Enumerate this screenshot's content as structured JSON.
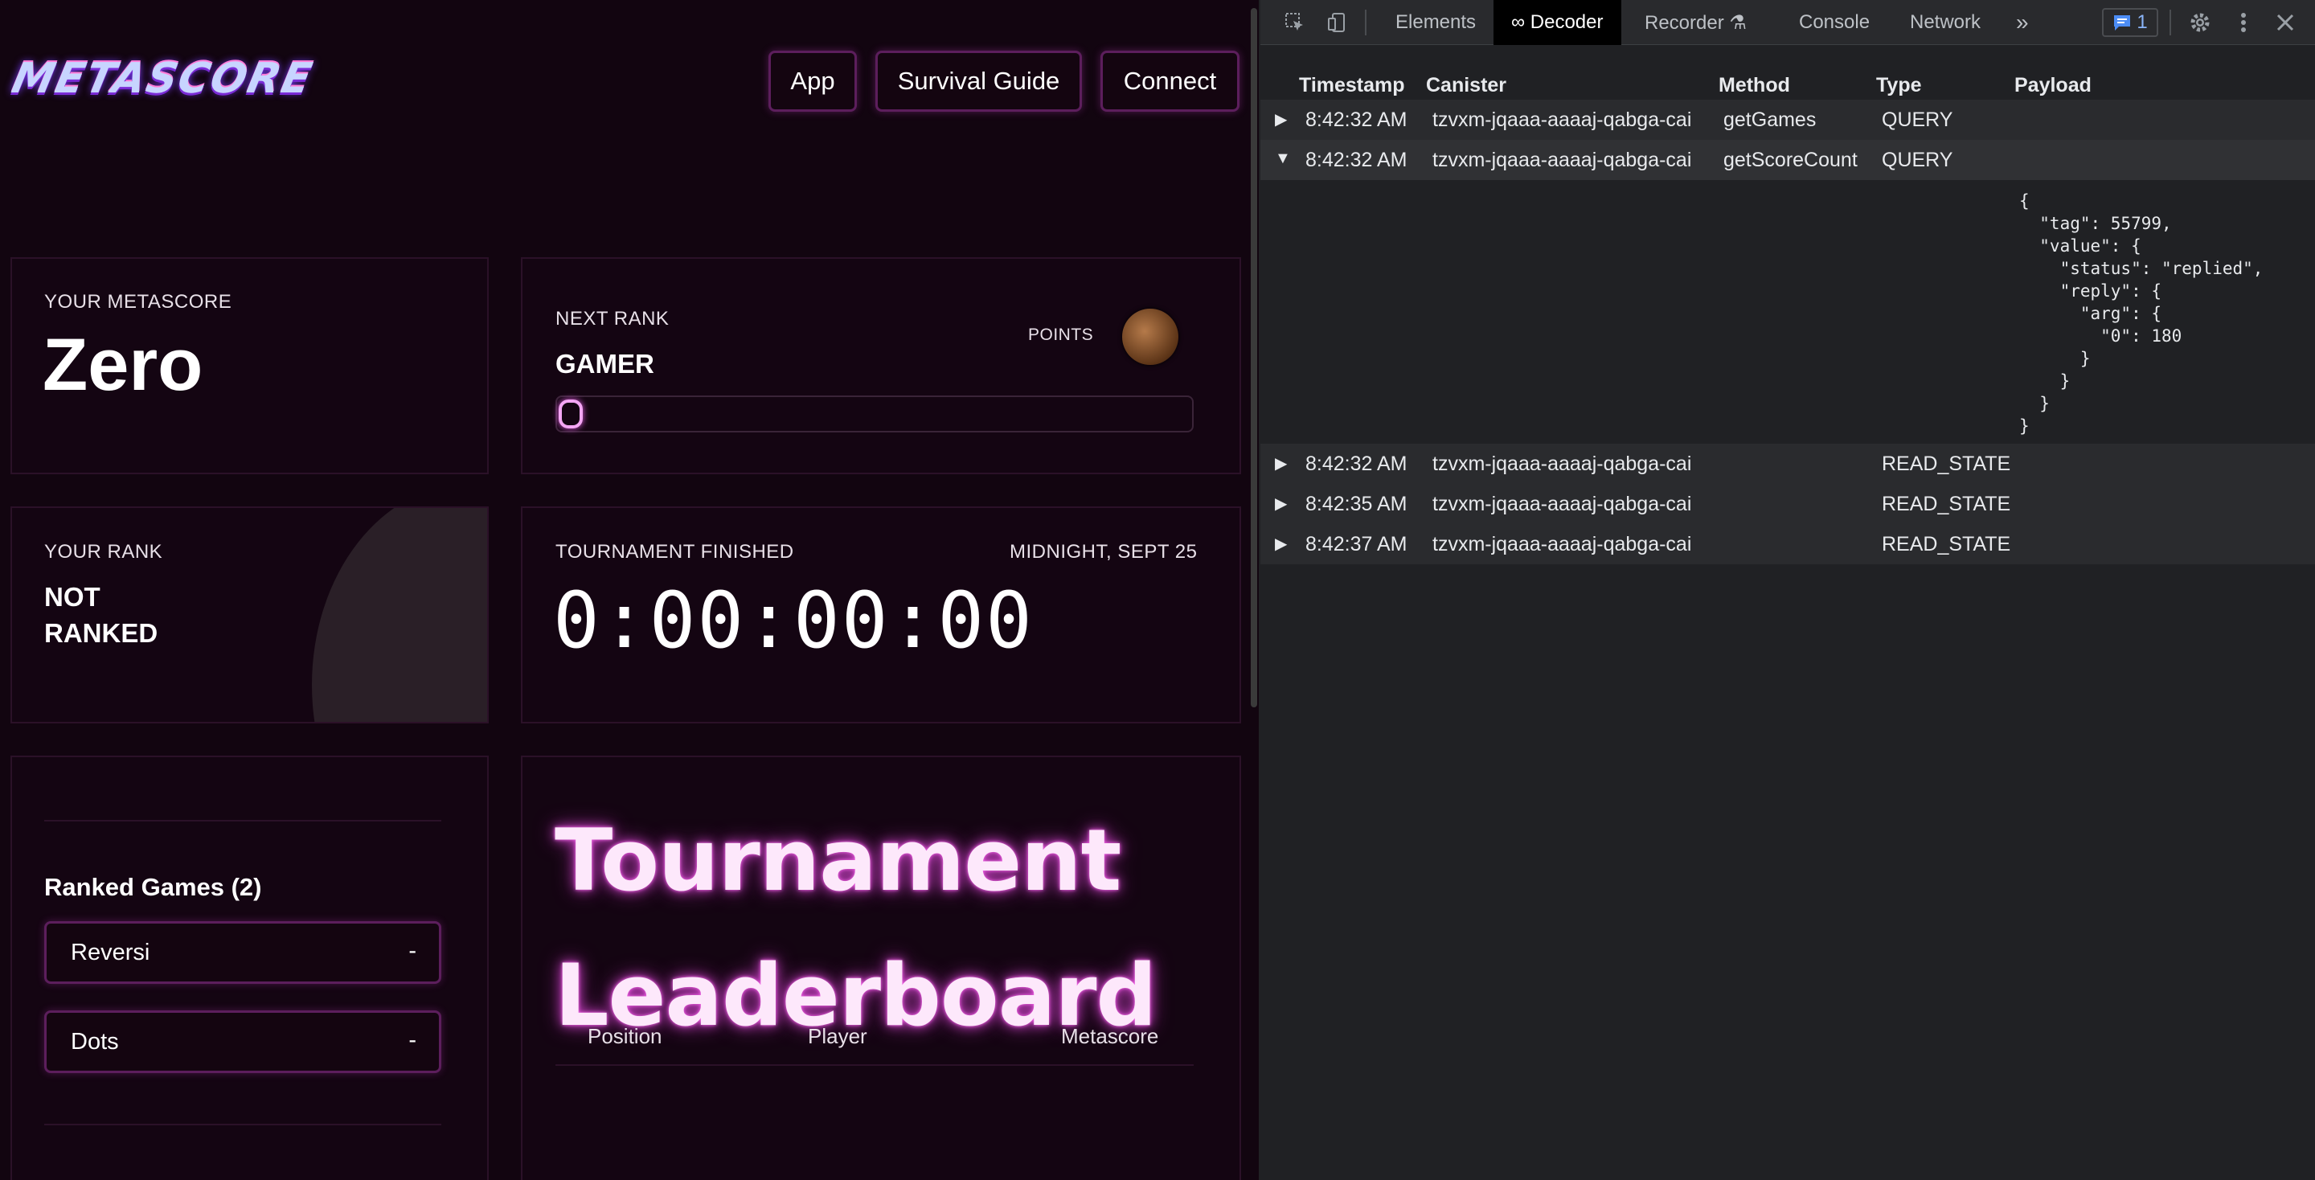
{
  "app": {
    "logo": "METASCORE",
    "nav": [
      "App",
      "Survival Guide",
      "Connect"
    ],
    "metascore": {
      "label": "YOUR METASCORE",
      "value": "Zero"
    },
    "next_rank": {
      "label": "NEXT RANK",
      "rank": "GAMER",
      "points_label": "POINTS",
      "progress": 0.0
    },
    "your_rank": {
      "label": "YOUR RANK",
      "line1": "NOT",
      "line2": "RANKED"
    },
    "tournament": {
      "label": "TOURNAMENT FINISHED",
      "date": "MIDNIGHT, SEPT 25",
      "countdown": "0:00:00:00"
    },
    "ranked_games": {
      "title": "Ranked Games (2)",
      "games": [
        {
          "name": "Reversi",
          "value": "-"
        },
        {
          "name": "Dots",
          "value": "-"
        }
      ]
    },
    "leaderboard": {
      "title_line1": "Tournament",
      "title_line2": "Leaderboard",
      "columns": [
        "Position",
        "Player",
        "Metascore"
      ]
    }
  },
  "devtools": {
    "tabs": [
      "Elements",
      "∞ Decoder",
      "Recorder ⚗",
      "Console",
      "Network",
      "»"
    ],
    "issues_count": "1",
    "columns": [
      "Timestamp",
      "Canister",
      "Method",
      "Type",
      "Payload"
    ],
    "rows": [
      {
        "toggle": "▶",
        "timestamp": "8:42:32 AM",
        "canister": "tzvxm-jqaaa-aaaaj-qabga-cai",
        "method": "getGames",
        "type": "QUERY"
      },
      {
        "toggle": "▼",
        "timestamp": "8:42:32 AM",
        "canister": "tzvxm-jqaaa-aaaaj-qabga-cai",
        "method": "getScoreCount",
        "type": "QUERY"
      },
      {
        "toggle": "▶",
        "timestamp": "8:42:32 AM",
        "canister": "tzvxm-jqaaa-aaaaj-qabga-cai",
        "method": "",
        "type": "READ_STATE"
      },
      {
        "toggle": "▶",
        "timestamp": "8:42:35 AM",
        "canister": "tzvxm-jqaaa-aaaaj-qabga-cai",
        "method": "",
        "type": "READ_STATE"
      },
      {
        "toggle": "▶",
        "timestamp": "8:42:37 AM",
        "canister": "tzvxm-jqaaa-aaaaj-qabga-cai",
        "method": "",
        "type": "READ_STATE"
      }
    ],
    "payload": "{\n  \"tag\": 55799,\n  \"value\": {\n    \"status\": \"replied\",\n    \"reply\": {\n      \"arg\": {\n        \"0\": 180\n      }\n    }\n  }\n}"
  }
}
